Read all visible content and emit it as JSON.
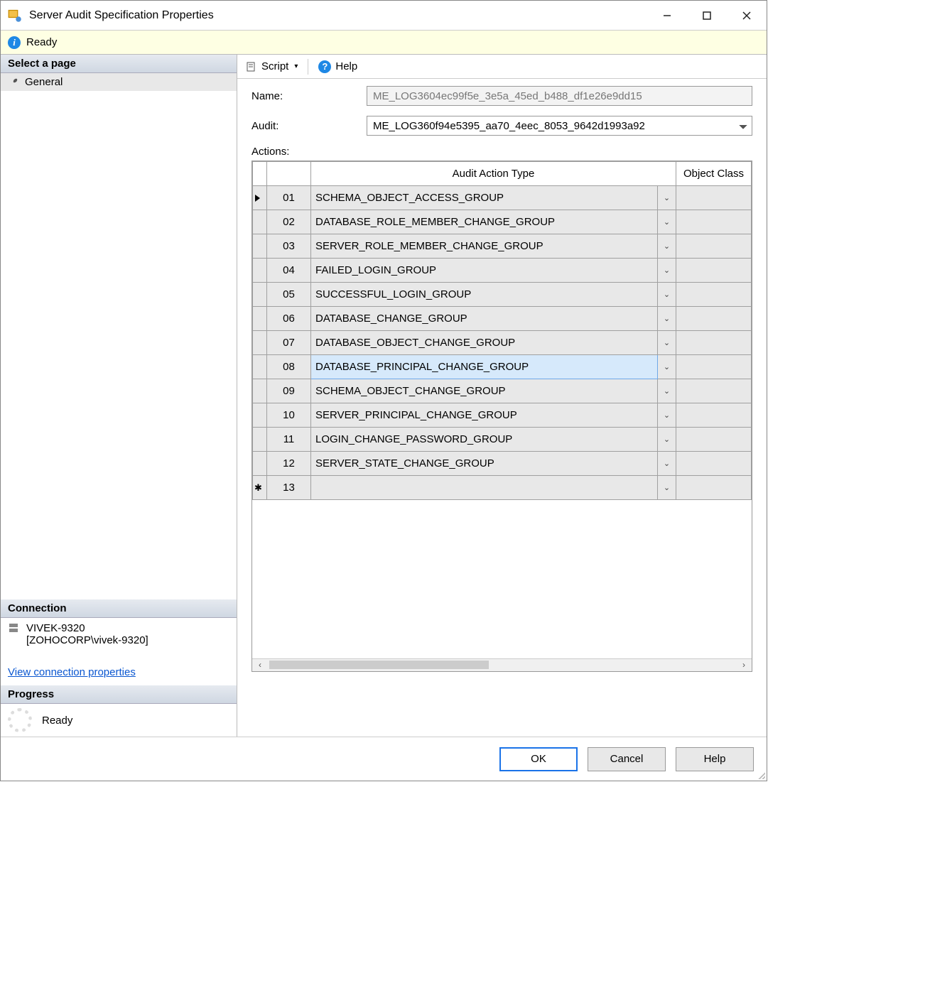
{
  "window": {
    "title": "Server Audit Specification Properties"
  },
  "status": {
    "text": "Ready"
  },
  "sidebar": {
    "header_select_page": "Select a page",
    "general_item": "General",
    "header_connection": "Connection",
    "server_name": "VIVEK-9320",
    "server_user": "[ZOHOCORP\\vivek-9320]",
    "view_conn_link": "View connection properties",
    "header_progress": "Progress",
    "progress_text": "Ready"
  },
  "toolbar": {
    "script_label": "Script",
    "help_label": "Help"
  },
  "form": {
    "name_label": "Name:",
    "name_value": "ME_LOG3604ec99f5e_3e5a_45ed_b488_df1e26e9dd15",
    "audit_label": "Audit:",
    "audit_value": "ME_LOG360f94e5395_aa70_4eec_8053_9642d1993a92",
    "actions_label": "Actions:"
  },
  "grid": {
    "col_action": "Audit Action Type",
    "col_objcls": "Object Class",
    "rows": [
      {
        "n": "01",
        "action": "SCHEMA_OBJECT_ACCESS_GROUP",
        "current": true
      },
      {
        "n": "02",
        "action": "DATABASE_ROLE_MEMBER_CHANGE_GROUP"
      },
      {
        "n": "03",
        "action": "SERVER_ROLE_MEMBER_CHANGE_GROUP"
      },
      {
        "n": "04",
        "action": "FAILED_LOGIN_GROUP"
      },
      {
        "n": "05",
        "action": "SUCCESSFUL_LOGIN_GROUP"
      },
      {
        "n": "06",
        "action": "DATABASE_CHANGE_GROUP"
      },
      {
        "n": "07",
        "action": "DATABASE_OBJECT_CHANGE_GROUP"
      },
      {
        "n": "08",
        "action": "DATABASE_PRINCIPAL_CHANGE_GROUP",
        "selected": true
      },
      {
        "n": "09",
        "action": "SCHEMA_OBJECT_CHANGE_GROUP"
      },
      {
        "n": "10",
        "action": "SERVER_PRINCIPAL_CHANGE_GROUP"
      },
      {
        "n": "11",
        "action": "LOGIN_CHANGE_PASSWORD_GROUP"
      },
      {
        "n": "12",
        "action": "SERVER_STATE_CHANGE_GROUP"
      },
      {
        "n": "13",
        "action": "",
        "new": true
      }
    ]
  },
  "footer": {
    "ok": "OK",
    "cancel": "Cancel",
    "help": "Help"
  }
}
